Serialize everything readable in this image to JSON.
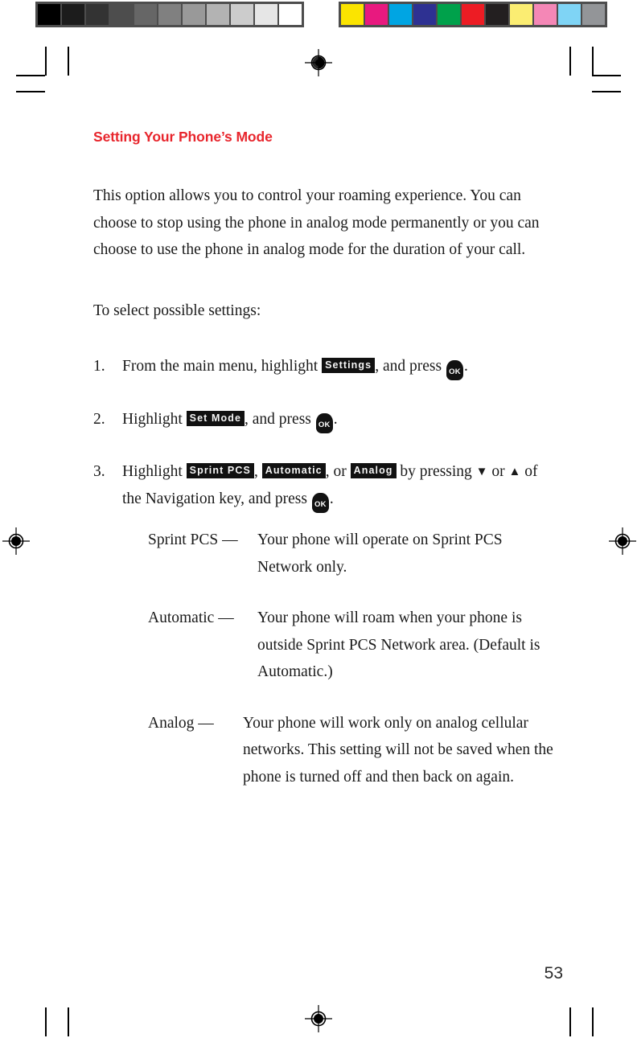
{
  "document": {
    "page_number": "53",
    "heading": "Setting Your Phone’s Mode",
    "heading_color": "#e8262d"
  },
  "body": {
    "intro_paragraph": "This option allows you to control your roaming experience. You can choose to stop using the phone in analog mode permanently or you can choose to use the phone in analog mode for the duration of your call.",
    "lead_line": "To select possible settings:"
  },
  "steps": [
    {
      "number": "1.",
      "text_before": "From the main menu, highlight",
      "menu_label": "Settings",
      "text_middle": ", and press",
      "key": "OK",
      "text_after": "."
    },
    {
      "number": "2.",
      "text_before": "Highlight",
      "menu_label": "Set Mode",
      "text_middle": ", and press",
      "key": "OK",
      "text_after": "."
    },
    {
      "number": "3.",
      "text_before": "Highlight",
      "menu_label_1": "Sprint PCS",
      "separator_1": ",",
      "menu_label_2": "Automatic",
      "separator_2": ", or",
      "menu_label_3": "Analog",
      "text_middle": "by pressing",
      "arrow_down": "▼",
      "text_or": "or",
      "arrow_up": "▲",
      "text_nav": "of the Navigation key, and press",
      "key": "OK",
      "text_after": "."
    }
  ],
  "definitions": [
    {
      "term": "Sprint PCS —",
      "description": "Your phone will operate on Sprint PCS Network only."
    },
    {
      "term": "Automatic —",
      "description": "Your phone will roam when your phone is outside Sprint PCS Network area. (Default is Automatic.)"
    },
    {
      "term": "Analog —",
      "description": "Your phone will work only on analog cellular networks. This setting will not be saved when the phone is turned off and then back on again."
    }
  ],
  "prepress": {
    "grayscale_patches": [
      "#000000",
      "#1c1c1c",
      "#333333",
      "#4d4d4d",
      "#666666",
      "#808080",
      "#999999",
      "#b3b3b3",
      "#cccccc",
      "#e6e6e6",
      "#ffffff"
    ],
    "color_patches": [
      "#fbe400",
      "#e8197f",
      "#00a5e3",
      "#2e3192",
      "#00a14b",
      "#ed1c24",
      "#231f20",
      "#fbed72",
      "#f487b6",
      "#7fd4f5",
      "#939598"
    ]
  }
}
